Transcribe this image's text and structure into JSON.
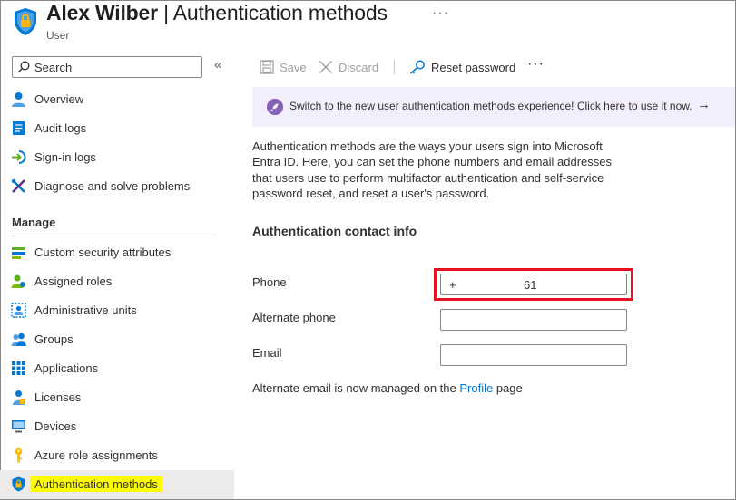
{
  "header": {
    "name": "Alex Wilber",
    "separator": "|",
    "page": "Authentication methods",
    "subtitle": "User",
    "more": "···"
  },
  "sidebar": {
    "search_placeholder": "Search",
    "collapse": "«",
    "top_items": [
      {
        "label": "Overview",
        "icon": "user-icon"
      },
      {
        "label": "Audit logs",
        "icon": "audit-log-icon"
      },
      {
        "label": "Sign-in logs",
        "icon": "sign-in-icon"
      },
      {
        "label": "Diagnose and solve problems",
        "icon": "wrench-icon"
      }
    ],
    "section_label": "Manage",
    "manage_items": [
      {
        "label": "Custom security attributes",
        "icon": "attributes-icon"
      },
      {
        "label": "Assigned roles",
        "icon": "roles-icon"
      },
      {
        "label": "Administrative units",
        "icon": "admin-units-icon"
      },
      {
        "label": "Groups",
        "icon": "groups-icon"
      },
      {
        "label": "Applications",
        "icon": "grid-icon"
      },
      {
        "label": "Licenses",
        "icon": "license-icon"
      },
      {
        "label": "Devices",
        "icon": "device-icon"
      },
      {
        "label": "Azure role assignments",
        "icon": "key-icon"
      },
      {
        "label": "Authentication methods",
        "icon": "shield-icon",
        "active": true
      }
    ]
  },
  "toolbar": {
    "save": "Save",
    "discard": "Discard",
    "reset_password": "Reset password",
    "more": "···"
  },
  "banner": {
    "text": "Switch to the new user authentication methods experience! Click here to use it now.",
    "arrow": "→"
  },
  "description": "Authentication methods are the ways your users sign into Microsoft Entra ID. Here, you can set the phone numbers and email addresses that users use to perform multifactor authentication and self-service password reset, and reset a user's password.",
  "contact": {
    "heading": "Authentication contact info",
    "phone_label": "Phone",
    "phone_prefix": "+",
    "phone_value": "61",
    "alt_phone_label": "Alternate phone",
    "alt_phone_value": "",
    "email_label": "Email",
    "email_value": ""
  },
  "note": {
    "before": "Alternate email is now managed on the ",
    "link": "Profile",
    "after": " page"
  },
  "colors": {
    "accent": "#0078d4",
    "highlight": "#ffff00",
    "annotation": "#e81123",
    "banner_bg": "#f3eefb"
  }
}
